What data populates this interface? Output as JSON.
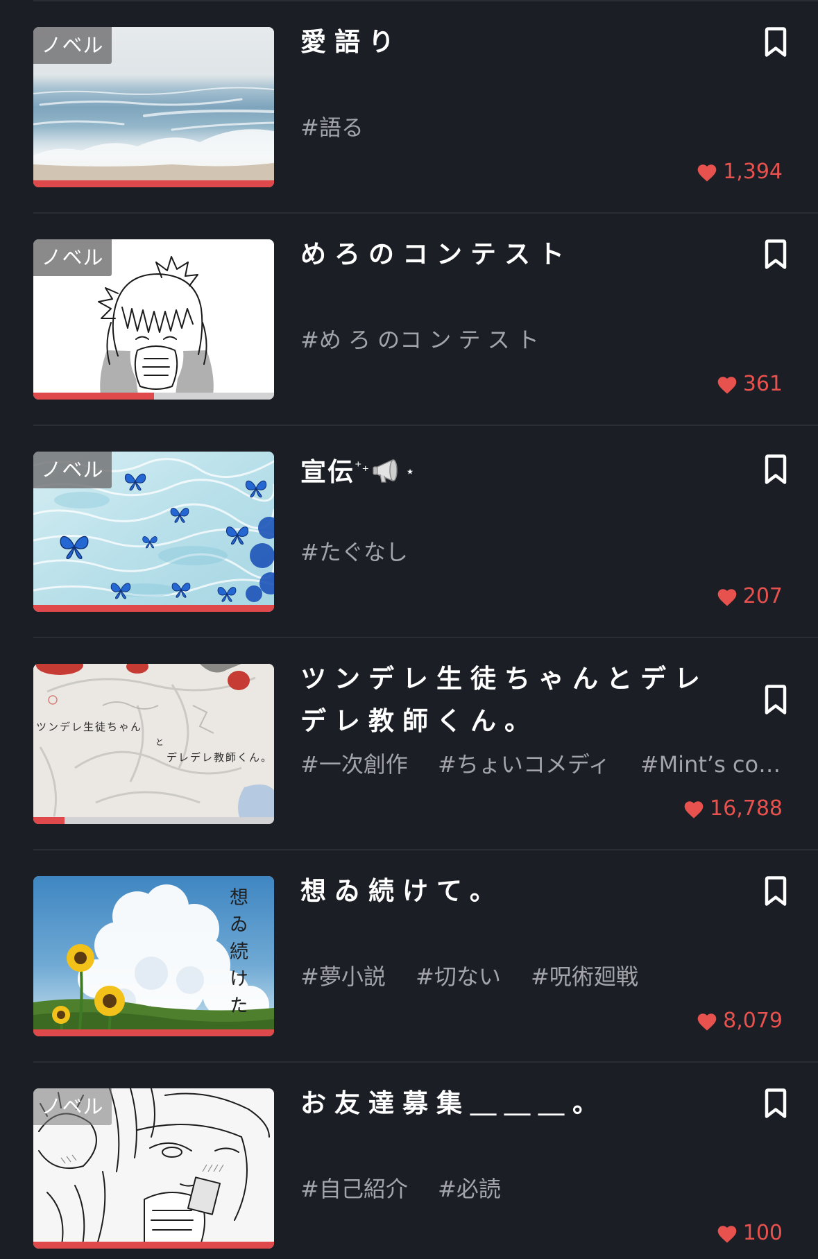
{
  "theme": {
    "background": "#1b1e25",
    "accent": "#e8524e",
    "tag_color": "#a3a5aa",
    "divider": "#2a2d34",
    "progress_fill": "#e0494b"
  },
  "icons": {
    "bookmark": "bookmark-icon",
    "like": "heart-icon",
    "title_emoji": "megaphone-icon"
  },
  "items": [
    {
      "badge": "ノベル",
      "title": "愛語り",
      "tags": [
        "#語る"
      ],
      "likes": "1,394",
      "progress": 1.0
    },
    {
      "badge": "ノベル",
      "title": "めろのコンテスト",
      "tags": [
        "#め ろ のコ ン テ ス ト"
      ],
      "likes": "361",
      "progress": 0.5
    },
    {
      "badge": "ノベル",
      "title": "宣伝",
      "title_decor": [
        "⁺₊",
        "⋆"
      ],
      "tags": [
        "#たぐなし"
      ],
      "likes": "207",
      "progress": 1.0
    },
    {
      "title": "ツンデレ生徒ちゃんとデレデレ教師くん。",
      "tags": [
        "#一次創作",
        "#ちょいコメディ",
        "#Mint’s co…"
      ],
      "likes": "16,788",
      "progress": 0.13,
      "cover_text": [
        "ツンデレ生徒ちゃん",
        "と",
        "デレデレ教師くん。"
      ]
    },
    {
      "title": "想ゐ続けて。",
      "tags": [
        "#夢小説",
        "#切ない",
        "#呪術廻戦"
      ],
      "likes": "8,079",
      "progress": 1.0,
      "cover_text": "想ゐ続けた"
    },
    {
      "badge": "ノベル",
      "title": "お友達募集＿＿＿。",
      "tags": [
        "#自己紹介",
        "#必読"
      ],
      "likes": "100",
      "progress": 1.0
    }
  ]
}
